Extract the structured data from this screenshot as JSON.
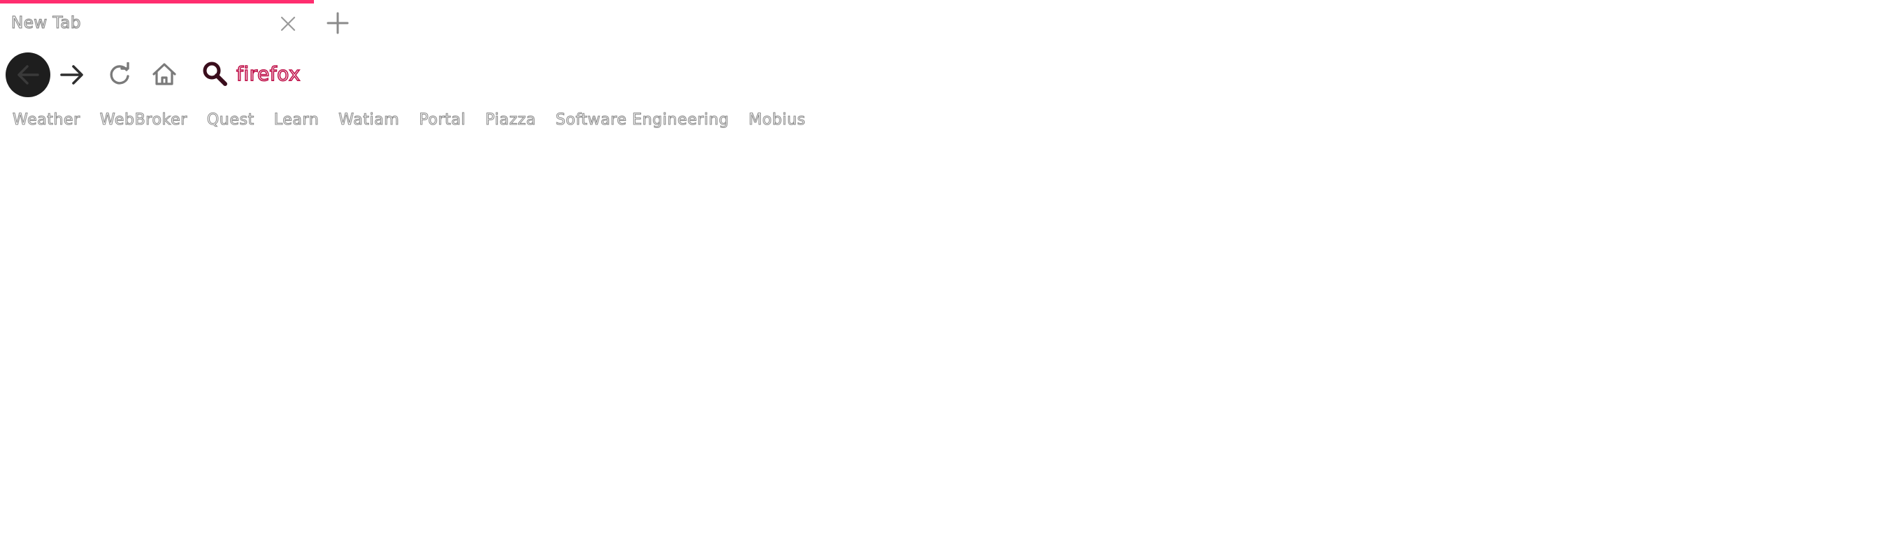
{
  "tab": {
    "title": "New Tab",
    "active_indicator_color": "#ff2d6f",
    "close_icon": "close-icon"
  },
  "new_tab_icon": "plus-icon",
  "navigation": {
    "back_icon": "arrow-left-icon",
    "forward_icon": "arrow-right-icon",
    "reload_icon": "reload-icon",
    "home_icon": "home-icon"
  },
  "url_bar": {
    "search_icon": "search-icon",
    "value": "firefox",
    "accent_color": "#c0144c"
  },
  "bookmarks": [
    {
      "label": "Weather"
    },
    {
      "label": "WebBroker"
    },
    {
      "label": "Quest"
    },
    {
      "label": "Learn"
    },
    {
      "label": "Watiam"
    },
    {
      "label": "Portal"
    },
    {
      "label": "Piazza"
    },
    {
      "label": "Software Engineering"
    },
    {
      "label": "Mobius"
    }
  ]
}
